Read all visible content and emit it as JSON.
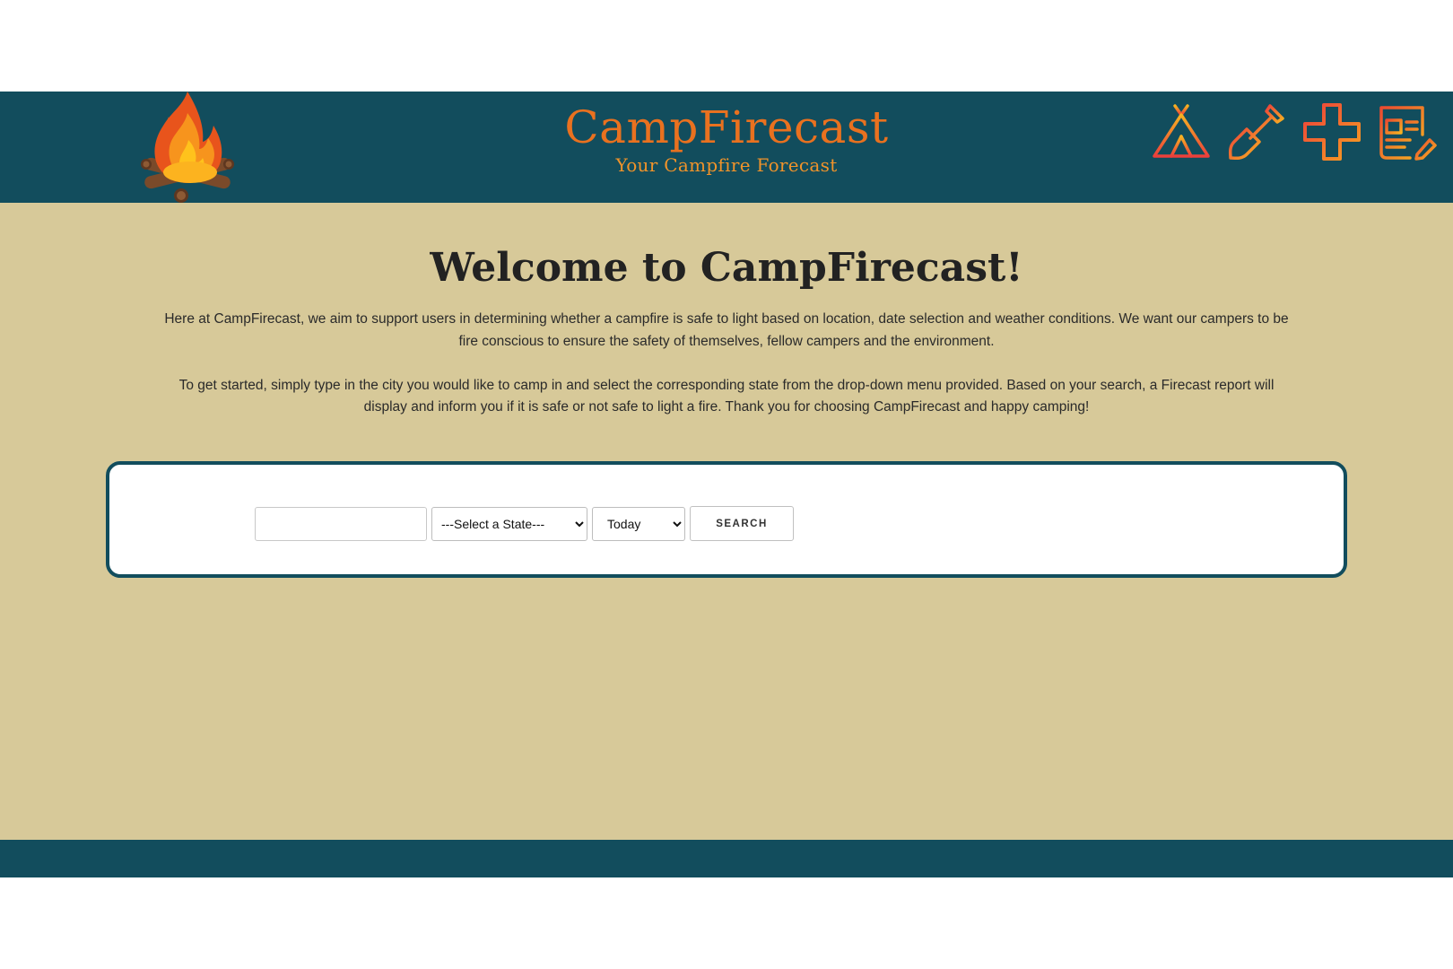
{
  "header": {
    "logo_icon": "campfire-icon",
    "title": "CampFirecast",
    "subtitle": "Your Campfire Forecast",
    "nav_icons": [
      "tent-icon",
      "shovel-icon",
      "first-aid-cross-icon",
      "news-article-icon"
    ]
  },
  "main": {
    "heading": "Welcome to CampFirecast!",
    "paragraph_1": "Here at CampFirecast, we aim to support users in determining whether a campfire is safe to light based on location, date selection and weather conditions. We want our campers to be fire conscious to ensure the safety of themselves, fellow campers and the environment.",
    "paragraph_2": "To get started, simply type in the city you would like to camp in and select the corresponding state from the drop-down menu provided. Based on your search, a Firecast report will display and inform you if it is safe or not safe to light a fire. Thank you for choosing CampFirecast and happy camping!"
  },
  "search": {
    "city_value": "",
    "state_selected": "---Select a State---",
    "date_selected": "Today",
    "button_label": "SEARCH"
  },
  "colors": {
    "header_bg": "#124d5d",
    "main_bg": "#d7c999",
    "title_orange": "#e9711f",
    "subtitle_orange": "#f0932a"
  }
}
